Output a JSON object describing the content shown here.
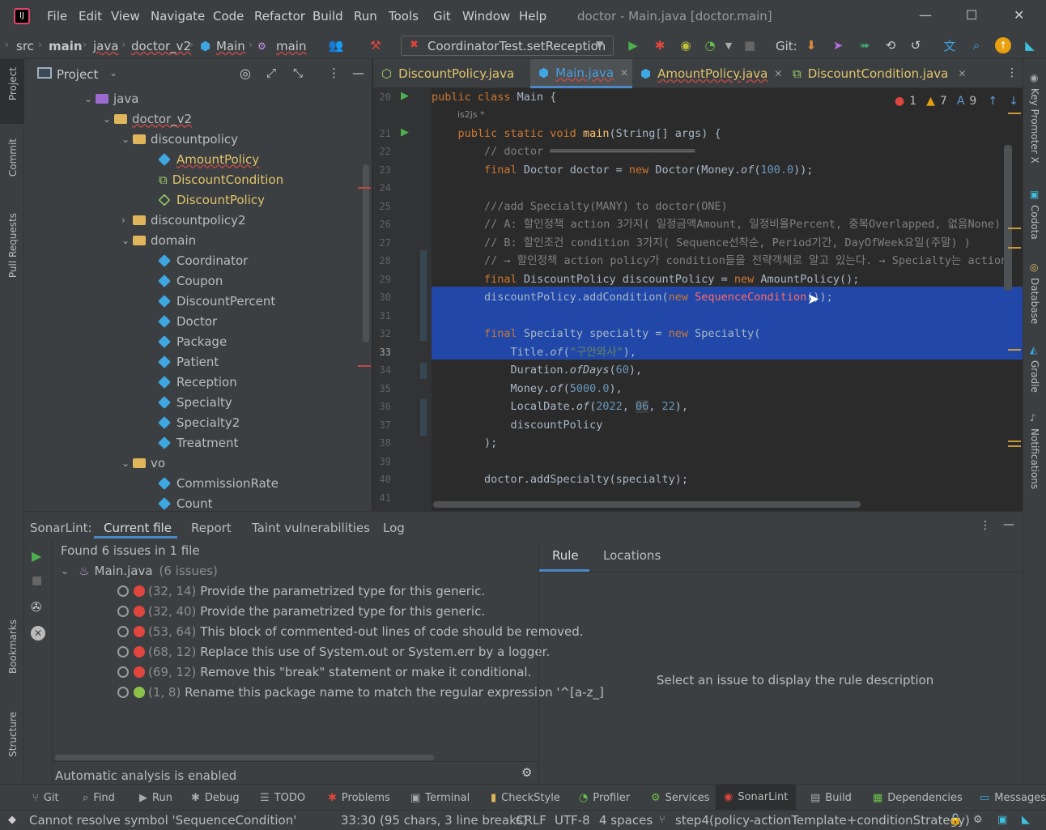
{
  "titlebar": {
    "menu": [
      "File",
      "Edit",
      "View",
      "Navigate",
      "Code",
      "Refactor",
      "Build",
      "Run",
      "Tools",
      "Git",
      "Window",
      "Help"
    ],
    "window_title": "doctor - Main.java [doctor.main]"
  },
  "navbar": {
    "breadcrumbs": [
      "src",
      "main",
      "java",
      "doctor_v2",
      "Main",
      "main"
    ],
    "run_config": "CoordinatorTest.setReception",
    "git_label": "Git:"
  },
  "left_stripe": {
    "project": "Project",
    "commit": "Commit",
    "pull_requests": "Pull Requests",
    "bookmarks": "Bookmarks",
    "structure": "Structure"
  },
  "right_stripe": {
    "key_promoter": "Key Promoter X",
    "codota": "Codota",
    "database": "Database",
    "gradle": "Gradle",
    "notifications": "Notifications"
  },
  "project": {
    "title": "Project",
    "tree": [
      {
        "label": "java",
        "kind": "folder-src"
      },
      {
        "label": "doctor_v2",
        "kind": "folder"
      },
      {
        "label": "discountpolicy",
        "kind": "folder"
      },
      {
        "label": "AmountPolicy",
        "kind": "class-new"
      },
      {
        "label": "DiscountCondition",
        "kind": "interface-new"
      },
      {
        "label": "DiscountPolicy",
        "kind": "abstract-new"
      },
      {
        "label": "discountpolicy2",
        "kind": "folder-collapsed"
      },
      {
        "label": "domain",
        "kind": "folder"
      },
      {
        "label": "Coordinator",
        "kind": "class"
      },
      {
        "label": "Coupon",
        "kind": "class"
      },
      {
        "label": "DiscountPercent",
        "kind": "class"
      },
      {
        "label": "Doctor",
        "kind": "class"
      },
      {
        "label": "Package",
        "kind": "class"
      },
      {
        "label": "Patient",
        "kind": "class"
      },
      {
        "label": "Reception",
        "kind": "class"
      },
      {
        "label": "Specialty",
        "kind": "class"
      },
      {
        "label": "Specialty2",
        "kind": "class"
      },
      {
        "label": "Treatment",
        "kind": "class"
      },
      {
        "label": "vo",
        "kind": "folder"
      },
      {
        "label": "CommissionRate",
        "kind": "class"
      },
      {
        "label": "Count",
        "kind": "class"
      }
    ]
  },
  "editor": {
    "tabs": [
      "DiscountPolicy.java",
      "Main.java",
      "AmountPolicy.java",
      "DiscountCondition.java"
    ],
    "active_tab": "Main.java",
    "author_hint": "is2js *",
    "inspections": {
      "errors": "1",
      "warnings": "7",
      "typos": "9"
    },
    "line_numbers": [
      "20",
      "21",
      "22",
      "23",
      "24",
      "25",
      "26",
      "27",
      "28",
      "29",
      "30",
      "31",
      "32",
      "33",
      "34",
      "35",
      "36",
      "37",
      "38",
      "39",
      "40",
      "41"
    ],
    "lines": {
      "l20": "public class Main {",
      "l21": "    public static void main(String[] args) {",
      "l22": "        // doctor ══════════════════════",
      "l23": "        final Doctor doctor = new Doctor(Money.of(100.0));",
      "l25": "        ///add Specialty(MANY) to doctor(ONE)",
      "l26": "        // A: 할인정책 action 3가지( 일정금액Amount, 일정비율Percent, 중복Overlapped, 없음None)",
      "l27": "        // B: 할인조건 condition 3가지( Sequence선착순, Period기간, DayOfWeek요일(주말) )",
      "l28": "        // → 할인정책 action policy가 condition들을 전략객체로 알고 있는다. → Specialty는 action",
      "l29": "        final DiscountPolicy discountPolicy = new AmountPolicy();",
      "l30": "        discountPolicy.addCondition(new SequenceCondition());",
      "l32": "        final Specialty specialty = new Specialty(",
      "l33": "            Title.of(\"구안와사\"),",
      "l34": "            Duration.ofDays(60),",
      "l35": "            Money.of(5000.0),",
      "l36": "            LocalDate.of(2022, 06, 22),",
      "l37": "            discountPolicy",
      "l38": "        );",
      "l40": "        doctor.addSpecialty(specialty);"
    }
  },
  "sonarlint": {
    "title": "SonarLint:",
    "tabs": [
      "Current file",
      "Report",
      "Taint vulnerabilities",
      "Log"
    ],
    "summary": "Found 6 issues in 1 file",
    "file": "Main.java",
    "file_count": "(6 issues)",
    "issues": [
      {
        "loc": "(32, 14)",
        "msg": "Provide the parametrized type for this generic."
      },
      {
        "loc": "(32, 40)",
        "msg": "Provide the parametrized type for this generic."
      },
      {
        "loc": "(53, 64)",
        "msg": "This block of commented-out lines of code should be removed."
      },
      {
        "loc": "(68, 12)",
        "msg": "Replace this use of System.out or System.err by a logger."
      },
      {
        "loc": "(69, 12)",
        "msg": "Remove this \"break\" statement or make it conditional."
      },
      {
        "loc": "(1, 8)",
        "msg": "Rename this package name to match the regular expression '^[a-z_]"
      }
    ],
    "auto_analysis": "Automatic analysis is enabled",
    "rule_tabs": [
      "Rule",
      "Locations"
    ],
    "rule_placeholder": "Select an issue to display the rule description"
  },
  "toolwindows": [
    "Git",
    "Find",
    "Run",
    "Debug",
    "TODO",
    "Problems",
    "Terminal",
    "CheckStyle",
    "Profiler",
    "Services",
    "SonarLint",
    "Build",
    "Dependencies",
    "Messages"
  ],
  "status": {
    "message": "Cannot resolve symbol 'SequenceCondition'",
    "position": "33:30 (95 chars, 3 line breaks)",
    "line_sep": "CRLF",
    "encoding": "UTF-8",
    "indent": "4 spaces",
    "branch": "step4(policy-actionTemplate+conditionStrategy)"
  },
  "colors": {
    "accent": "#4a88c7",
    "selection": "#2148a8",
    "keyword": "#cc7832",
    "error": "#e0463e"
  }
}
